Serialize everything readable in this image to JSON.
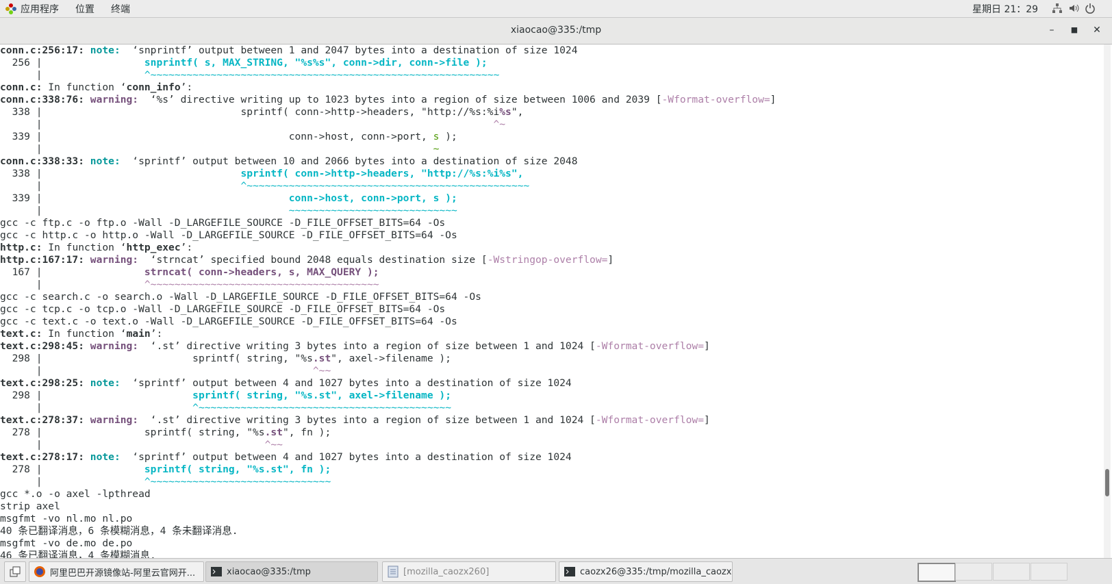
{
  "top_panel": {
    "apps": "应用程序",
    "places": "位置",
    "terminal": "终端",
    "clock": "星期日 21：29"
  },
  "window": {
    "title": "xiaocao@335:/tmp"
  },
  "terminal": {
    "lines": [
      [
        [
          "conn.c:256:17: ",
          "loc"
        ],
        [
          "note: ",
          "note"
        ],
        [
          " ‘snprintf’ output between 1 and 2047 bytes into a destination of size 1024",
          ""
        ]
      ],
      [
        [
          "  256 |                 ",
          ""
        ],
        [
          "snprintf( s, MAX_STRING, \"%s%s\", conn->dir, conn->file );",
          "hl-c"
        ]
      ],
      [
        [
          "      |                 ",
          ""
        ],
        [
          "^~~~~~~~~~~~~~~~~~~~~~~~~~~~~~~~~~~~~~~~~~~~~~~~~~~~~~~~~~~",
          "tilde-c"
        ]
      ],
      [
        [
          "conn.c:",
          "loc"
        ],
        [
          " In function ‘",
          ""
        ],
        [
          "conn_info",
          "loc"
        ],
        [
          "’:",
          ""
        ]
      ],
      [
        [
          "conn.c:338:76: ",
          "loc"
        ],
        [
          "warning: ",
          "warn"
        ],
        [
          " ‘%s’ directive writing up to 1023 bytes into a region of size between 1006 and 2039 [",
          ""
        ],
        [
          "-Wformat-overflow=",
          "flag"
        ],
        [
          "]",
          ""
        ]
      ],
      [
        [
          "  338 |                                 sprintf( conn->http->headers, \"http://%s:%i",
          ""
        ],
        [
          "%s",
          "hl-m"
        ],
        [
          "\",",
          ""
        ]
      ],
      [
        [
          "      |                                                                           ",
          ""
        ],
        [
          "^~",
          "tilde-m"
        ]
      ],
      [
        [
          "  339 |                                         conn->host, conn->port, ",
          ""
        ],
        [
          "s",
          "tilde-g"
        ],
        [
          " );",
          ""
        ]
      ],
      [
        [
          "      |                                                                 ",
          ""
        ],
        [
          "~",
          "tilde-g"
        ]
      ],
      [
        [
          "conn.c:338:33: ",
          "loc"
        ],
        [
          "note: ",
          "note"
        ],
        [
          " ‘sprintf’ output between 10 and 2066 bytes into a destination of size 2048",
          ""
        ]
      ],
      [
        [
          "  338 |                                 ",
          ""
        ],
        [
          "sprintf( conn->http->headers, \"http://%s:%i%s\",",
          "hl-c"
        ]
      ],
      [
        [
          "      |                                 ",
          ""
        ],
        [
          "^~~~~~~~~~~~~~~~~~~~~~~~~~~~~~~~~~~~~~~~~~~~~~~~",
          "tilde-c"
        ]
      ],
      [
        [
          "  339 |                                         ",
          ""
        ],
        [
          "conn->host, conn->port, s );",
          "hl-c"
        ]
      ],
      [
        [
          "      |                                         ",
          ""
        ],
        [
          "~~~~~~~~~~~~~~~~~~~~~~~~~~~~",
          "tilde-c"
        ]
      ],
      [
        [
          "gcc -c ftp.c -o ftp.o -Wall -D_LARGEFILE_SOURCE -D_FILE_OFFSET_BITS=64 -Os",
          ""
        ]
      ],
      [
        [
          "gcc -c http.c -o http.o -Wall -D_LARGEFILE_SOURCE -D_FILE_OFFSET_BITS=64 -Os",
          ""
        ]
      ],
      [
        [
          "http.c:",
          "loc"
        ],
        [
          " In function ‘",
          ""
        ],
        [
          "http_exec",
          "loc"
        ],
        [
          "’:",
          ""
        ]
      ],
      [
        [
          "http.c:167:17: ",
          "loc"
        ],
        [
          "warning: ",
          "warn"
        ],
        [
          " ‘strncat’ specified bound 2048 equals destination size [",
          ""
        ],
        [
          "-Wstringop-overflow=",
          "flag"
        ],
        [
          "]",
          ""
        ]
      ],
      [
        [
          "  167 |                 ",
          ""
        ],
        [
          "strncat( conn->headers, s, MAX_QUERY );",
          "hl-m"
        ]
      ],
      [
        [
          "      |                 ",
          ""
        ],
        [
          "^~~~~~~~~~~~~~~~~~~~~~~~~~~~~~~~~~~~~~~",
          "tilde-m"
        ]
      ],
      [
        [
          "gcc -c search.c -o search.o -Wall -D_LARGEFILE_SOURCE -D_FILE_OFFSET_BITS=64 -Os",
          ""
        ]
      ],
      [
        [
          "gcc -c tcp.c -o tcp.o -Wall -D_LARGEFILE_SOURCE -D_FILE_OFFSET_BITS=64 -Os",
          ""
        ]
      ],
      [
        [
          "gcc -c text.c -o text.o -Wall -D_LARGEFILE_SOURCE -D_FILE_OFFSET_BITS=64 -Os",
          ""
        ]
      ],
      [
        [
          "text.c:",
          "loc"
        ],
        [
          " In function ‘",
          ""
        ],
        [
          "main",
          "loc"
        ],
        [
          "’:",
          ""
        ]
      ],
      [
        [
          "text.c:298:45: ",
          "loc"
        ],
        [
          "warning: ",
          "warn"
        ],
        [
          " ‘.st’ directive writing 3 bytes into a region of size between 1 and 1024 [",
          ""
        ],
        [
          "-Wformat-overflow=",
          "flag"
        ],
        [
          "]",
          ""
        ]
      ],
      [
        [
          "  298 |                         sprintf( string, \"%s",
          ""
        ],
        [
          ".st",
          "hl-m"
        ],
        [
          "\", axel->filename );",
          ""
        ]
      ],
      [
        [
          "      |                                             ",
          ""
        ],
        [
          "^~~",
          "tilde-m"
        ]
      ],
      [
        [
          "text.c:298:25: ",
          "loc"
        ],
        [
          "note: ",
          "note"
        ],
        [
          " ‘sprintf’ output between 4 and 1027 bytes into a destination of size 1024",
          ""
        ]
      ],
      [
        [
          "  298 |                         ",
          ""
        ],
        [
          "sprintf( string, \"%s.st\", axel->filename );",
          "hl-c"
        ]
      ],
      [
        [
          "      |                         ",
          ""
        ],
        [
          "^~~~~~~~~~~~~~~~~~~~~~~~~~~~~~~~~~~~~~~~~~~",
          "tilde-c"
        ]
      ],
      [
        [
          "text.c:278:37: ",
          "loc"
        ],
        [
          "warning: ",
          "warn"
        ],
        [
          " ‘.st’ directive writing 3 bytes into a region of size between 1 and 1024 [",
          ""
        ],
        [
          "-Wformat-overflow=",
          "flag"
        ],
        [
          "]",
          ""
        ]
      ],
      [
        [
          "  278 |                 sprintf( string, \"%s",
          ""
        ],
        [
          ".st",
          "hl-m"
        ],
        [
          "\", fn );",
          ""
        ]
      ],
      [
        [
          "      |                                     ",
          ""
        ],
        [
          "^~~",
          "tilde-m"
        ]
      ],
      [
        [
          "text.c:278:17: ",
          "loc"
        ],
        [
          "note: ",
          "note"
        ],
        [
          " ‘sprintf’ output between 4 and 1027 bytes into a destination of size 1024",
          ""
        ]
      ],
      [
        [
          "  278 |                 ",
          ""
        ],
        [
          "sprintf( string, \"%s.st\", fn );",
          "hl-c"
        ]
      ],
      [
        [
          "      |                 ",
          ""
        ],
        [
          "^~~~~~~~~~~~~~~~~~~~~~~~~~~~~~~",
          "tilde-c"
        ]
      ],
      [
        [
          "gcc *.o -o axel -lpthread",
          ""
        ]
      ],
      [
        [
          "strip axel",
          ""
        ]
      ],
      [
        [
          "msgfmt -vo nl.mo nl.po",
          ""
        ]
      ],
      [
        [
          "40 条已翻译消息，6 条模糊消息，4 条未翻译消息.",
          ""
        ]
      ],
      [
        [
          "msgfmt -vo de.mo de.po",
          ""
        ]
      ],
      [
        [
          "46 条已翻译消息，4 条模糊消息.",
          ""
        ]
      ]
    ]
  },
  "taskbar": {
    "tasks": [
      {
        "label": "阿里巴巴开源镜像站-阿里云官网开...",
        "icon": "firefox-icon"
      },
      {
        "label": "xiaocao@335:/tmp",
        "icon": "terminal-icon"
      },
      {
        "label": "[mozilla_caozx260]",
        "icon": "file-manager-icon"
      },
      {
        "label": "caozx26@335:/tmp/mozilla_caozx···",
        "icon": "terminal-icon"
      }
    ]
  },
  "colors": {
    "note": "#06989a",
    "warning": "#75507b",
    "highlight_cyan": "#06b6c4",
    "flag_magenta": "#ad7fa8"
  }
}
